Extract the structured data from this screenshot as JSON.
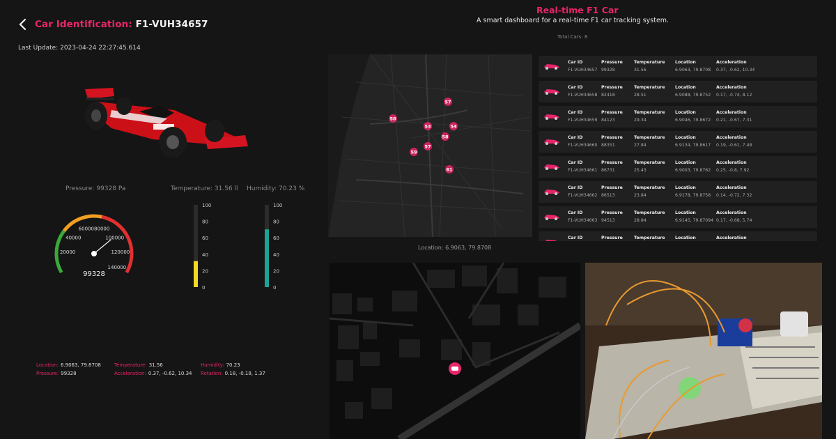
{
  "header": {
    "title_label": "Car Identification:",
    "title_value": "F1-VUH34657",
    "last_update": "Last Update: 2023-04-24 22:27:45.614"
  },
  "stats": {
    "pressure_label": "Pressure: 99328 Pa",
    "temperature_label": "Temperature: 31.56 ll",
    "humidity_label": "Humidity: 70.23 %"
  },
  "gauge": {
    "value": 99328,
    "min": 0,
    "max": 140000,
    "ticks": [
      "20000",
      "40000",
      "60000",
      "80000",
      "100000",
      "120000",
      "140000"
    ],
    "display": "99328"
  },
  "thermometers": [
    {
      "name": "temperature",
      "value": 31.56,
      "max": 100,
      "color": "#f5d820",
      "ticks": [
        "100",
        "80",
        "60",
        "40",
        "20",
        "0"
      ]
    },
    {
      "name": "humidity",
      "value": 70.23,
      "max": 100,
      "color": "#1aa596",
      "ticks": [
        "100",
        "80",
        "60",
        "40",
        "20",
        "0"
      ]
    }
  ],
  "readings": {
    "row1": [
      {
        "k": "Location:",
        "v": "6.9063, 79.8708"
      },
      {
        "k": "Temperature:",
        "v": "31.56"
      },
      {
        "k": "Humidity:",
        "v": "70.23"
      }
    ],
    "row2": [
      {
        "k": "Pressure:",
        "v": "99328"
      },
      {
        "k": "Acceleration:",
        "v": "0.37, -0.62, 10.34"
      },
      {
        "k": "Rotation:",
        "v": "0.18, -0.18, 1.37"
      }
    ]
  },
  "top": {
    "title": "Real-time F1 Car",
    "subtitle": "A smart dashboard for a real-time F1 car tracking system.",
    "total": "Total Cars: 8"
  },
  "map": {
    "location": "Location: 6.9063, 79.8708",
    "markers": [
      "57",
      "58",
      "53",
      "54",
      "58",
      "57",
      "59",
      "61"
    ]
  },
  "list": {
    "headers": [
      "Car ID",
      "Pressure",
      "Temperature",
      "Location",
      "Acceleration"
    ],
    "rows": [
      [
        "F1-VUH34657",
        "99328",
        "31.56",
        "6.9063, 79.8708",
        "0.37, -0.62, 10.34"
      ],
      [
        "F1-VUH34658",
        "82418",
        "28.51",
        "6.9088, 79.8752",
        "0.17, -0.74, 8.12"
      ],
      [
        "F1-VUH34659",
        "84123",
        "29.34",
        "6.9046, 79.8672",
        "0.21, -0.67, 7.31"
      ],
      [
        "F1-VUH34660",
        "88351",
        "27.84",
        "6.9134, 79.8617",
        "0.19, -0.61, 7.48"
      ],
      [
        "F1-VUH34661",
        "86731",
        "25.43",
        "6.9003, 79.8762",
        "0.25, -0.8, 7.92"
      ],
      [
        "F1-VUH34662",
        "86513",
        "23.84",
        "6.9178, 79.8758",
        "0.14, -0.72, 7.32"
      ],
      [
        "F1-VUH34663",
        "94513",
        "28.84",
        "6.9145, 79.87094",
        "0.17, -0.68, 5.74"
      ],
      [
        "",
        "",
        "",
        "",
        ""
      ]
    ]
  },
  "colors": {
    "accent": "#e8256a",
    "bg": "#151515"
  }
}
